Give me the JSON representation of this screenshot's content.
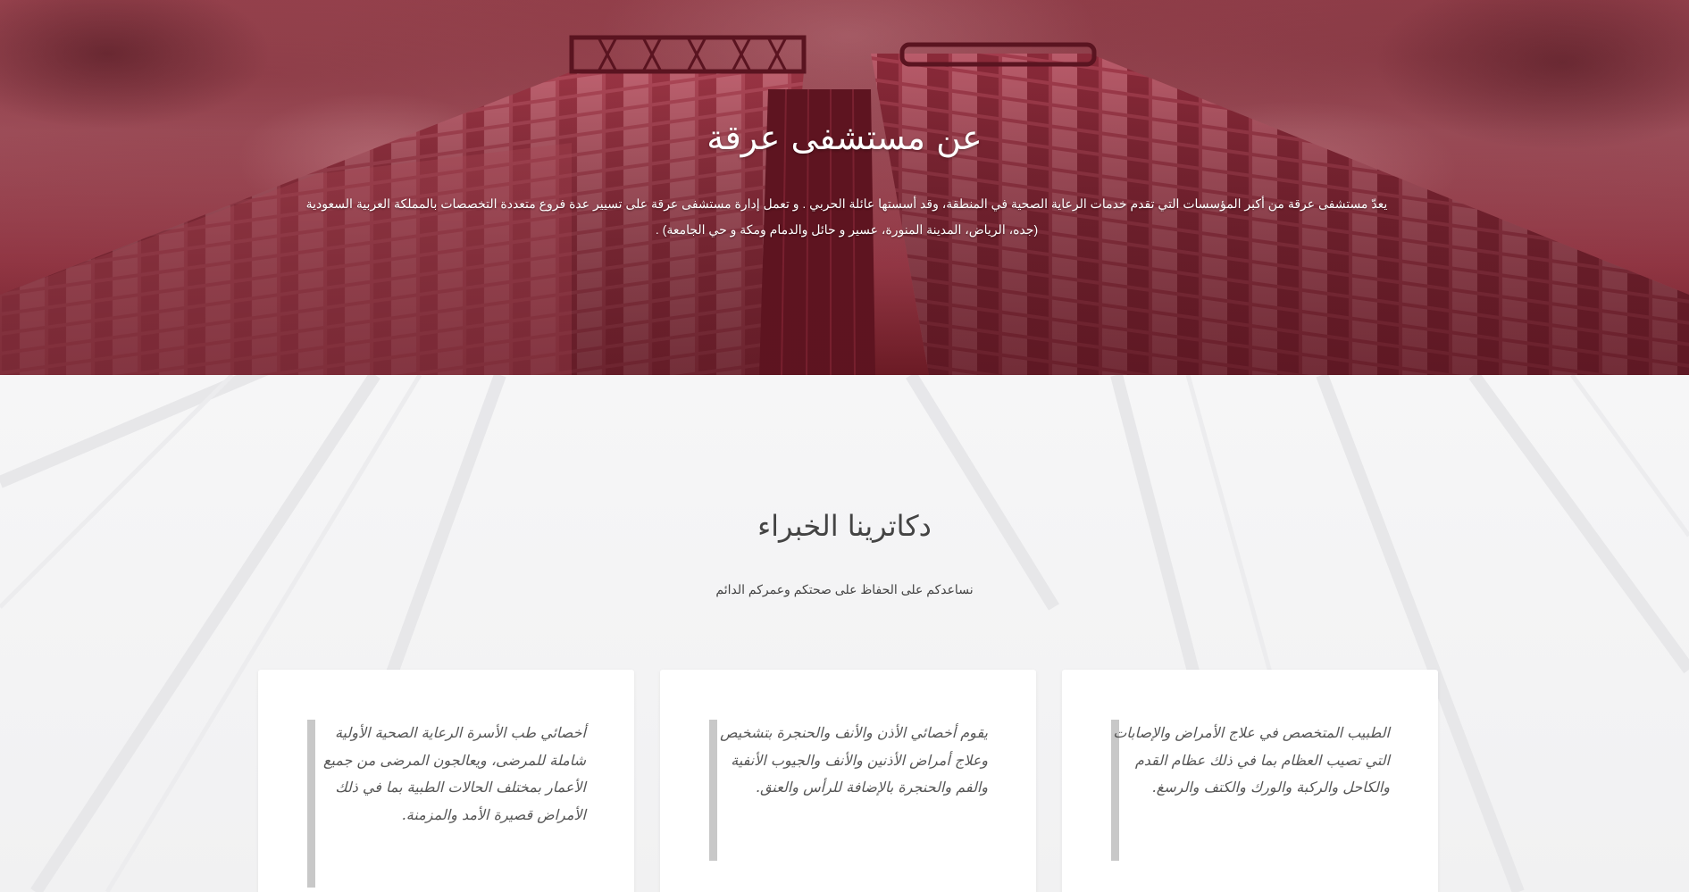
{
  "hero": {
    "title": "عن مستشفى عرقة",
    "text_line1": "يعدّ مستشفى عرقة من أكبر المؤسسات التي تقدم خدمات الرعاية الصحية في المنطقة، وقد أسستها عائلة الحربي . و تعمل إدارة مستشفى عرقة على تسيير عدة فروع متعددة التخصصات بالمملكة العربية السعودية",
    "text_line2": "(جده، الرياض، المدينة المنورة، عسير و حائل والدمام ومكة و حي الجامعة) ."
  },
  "doctors": {
    "title": "دكاترينا الخبراء",
    "subtitle": "نساعدكم على الحفاظ على صحتكم وعمركم الدائم",
    "cards": [
      {
        "text": "الطبيب المتخصص في علاج الأمراض والإصابات التي تصيب العظام بما في ذلك عظام القدم والكاحل والركبة والورك والكتف والرسغ."
      },
      {
        "text": "يقوم أخصائي الأذن والأنف والحنجرة بتشخيص وعلاج أمراض الأذنين والأنف والجيوب الأنفية والفم والحنجرة بالإضافة للرأس والعنق."
      },
      {
        "text": "أخصائي طب الأسرة الرعاية الصحية الأولية شاملة للمرضى، ويعالجون المرضى من جميع الأعمار بمختلف الحالات الطبية بما في ذلك الأمراض قصيرة الأمد والمزمنة."
      }
    ]
  },
  "colors": {
    "hero_tint": "#a9525e",
    "text_dark": "#444444",
    "card_bg": "#ffffff",
    "quote_bar": "#c8c8c8"
  }
}
